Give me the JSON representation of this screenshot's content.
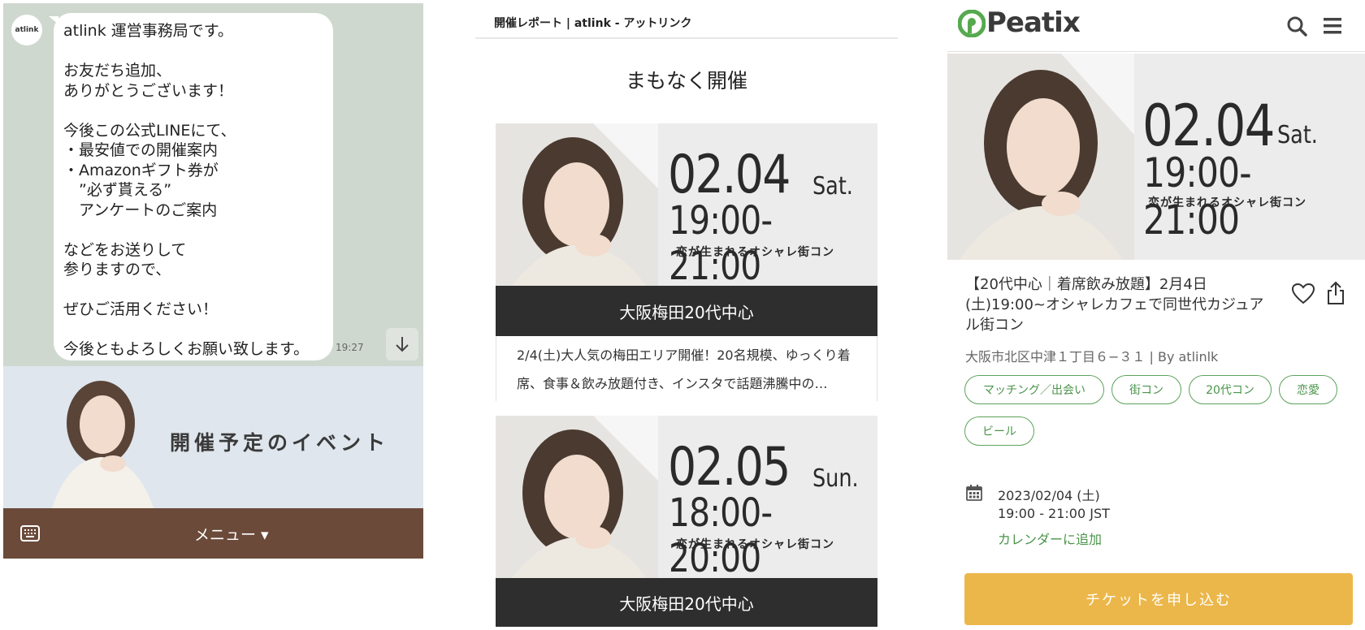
{
  "line": {
    "avatar_label": "atlink",
    "message_lines": [
      "atlink 運営事務局です。",
      "",
      "お友だち追加、",
      "ありがとうございます！",
      "",
      "今後この公式LINEにて、",
      "・最安値での開催案内",
      "・Amazonギフト券が",
      "　”必ず貰える”",
      "　アンケートのご案内",
      "",
      "などをお送りして",
      "参りますので、",
      "",
      "ぜひご活用ください！",
      "",
      "今後ともよろしくお願い致します。"
    ],
    "time": "19:27",
    "banner_title": "開催予定のイベント",
    "menu_label": "メニュー ▾",
    "colors": {
      "chat_bg": "#cfd8cf",
      "menu_bar": "#6b4a3a"
    }
  },
  "web": {
    "header_title": "開催レポート | atlink - アットリンク",
    "section_title": "まもなく開催",
    "events": [
      {
        "date": "02.04",
        "day": "Sat.",
        "time": "19:00-21:00",
        "tagline": "恋が生まれるオシャレ街コン",
        "location": "大阪梅田20代中心",
        "description": "2/4(土)大人気の梅田エリア開催！20名規模、ゆっくり着席、食事＆飲み放題付き、インスタで話題沸騰中の…"
      },
      {
        "date": "02.05",
        "day": "Sun.",
        "time": "18:00-20:00",
        "tagline": "恋が生まれるオシャレ街コン",
        "location": "大阪梅田20代中心"
      }
    ]
  },
  "peatix": {
    "logo_text": "Peatix",
    "hero": {
      "date": "02.04",
      "day": "Sat.",
      "time": "19:00-21:00",
      "tagline": "恋が生まれるオシャレ街コン"
    },
    "event_title": "【20代中心｜着席飲み放題】2月4日(土)19:00~オシャレカフェで同世代カジュアル街コン",
    "venue": "大阪市北区中津１丁目６−３１ | By atlinlk",
    "tags": [
      "マッチング／出会い",
      "街コン",
      "20代コン",
      "恋愛",
      "ビール"
    ],
    "date": "2023/02/04 (土)",
    "time": "19:00 - 21:00 JST",
    "add_calendar": "カレンダーに追加",
    "ticket_button": "チケットを申し込む",
    "colors": {
      "accent": "#4a944a",
      "ticket": "#ecb74a"
    }
  }
}
